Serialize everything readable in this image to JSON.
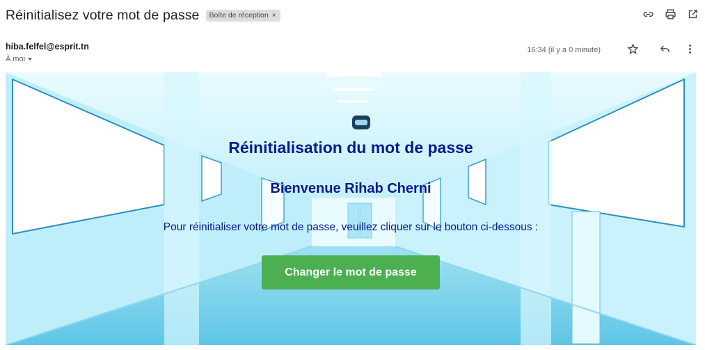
{
  "email": {
    "subject": "Réinitialisez votre mot de passe",
    "label": "Boîte de réception",
    "label_close": "×",
    "sender": "hiba.felfel@esprit.tn",
    "recipient": "À moi",
    "time": "16:34 (il y a 0 minute)"
  },
  "icons": {
    "open_link": "link-icon",
    "print": "print-icon",
    "new_window": "open-in-new-window-icon",
    "star": "star-icon",
    "reply": "reply-icon",
    "more": "more-vertical-icon"
  },
  "banner": {
    "title": "Réinitialisation du mot de passe",
    "welcome": "Bienvenue Rihab Cherni",
    "instruction": "Pour réinitialiser votre mot de passe, veuillez cliquer sur le bouton ci-dessous :",
    "button_label": "Changer le mot de passe"
  },
  "colors": {
    "heading": "#0a1a8c",
    "button": "#4caf50",
    "label_chip": "#dddddd"
  }
}
